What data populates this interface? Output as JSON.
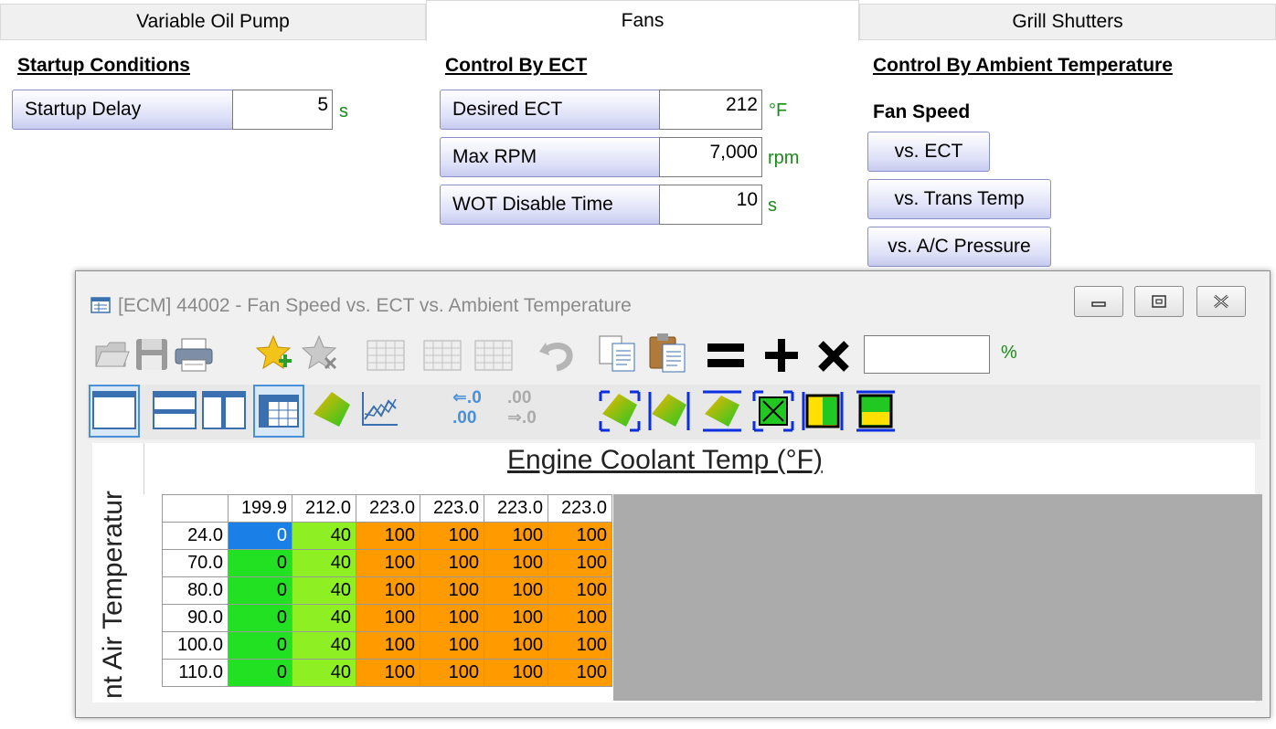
{
  "tabs": [
    {
      "label": "Variable Oil Pump"
    },
    {
      "label": "Fans"
    },
    {
      "label": "Grill Shutters"
    }
  ],
  "startup": {
    "title": "Startup Conditions",
    "delay_label": "Startup Delay",
    "delay_value": "5",
    "delay_unit": "s"
  },
  "ect_control": {
    "title": "Control By ECT",
    "desired_label": "Desired ECT",
    "desired_value": "212",
    "desired_unit": "°F",
    "maxrpm_label": "Max RPM",
    "maxrpm_value": "7,000",
    "maxrpm_unit": "rpm",
    "wot_label": "WOT Disable Time",
    "wot_value": "10",
    "wot_unit": "s"
  },
  "ambient_control": {
    "title": "Control By Ambient Temperature",
    "fan_speed_title": "Fan Speed",
    "btn_ect": "vs. ECT",
    "btn_trans": "vs. Trans Temp",
    "btn_ac": "vs. A/C Pressure"
  },
  "table_window": {
    "title": "[ECM] 44002 - Fan Speed vs. ECT vs. Ambient Temperature",
    "input_value": "",
    "input_unit": "%",
    "decimal_more": ".0",
    "decimal_more_2": ".00",
    "decimal_less": ".00",
    "decimal_less_2": ".0",
    "col_axis_title": "Engine Coolant Temp (°F)",
    "row_axis_title": "nt Air Temperatur",
    "col_headers": [
      "199.9",
      "212.0",
      "223.0",
      "223.0",
      "223.0",
      "223.0"
    ],
    "rows": [
      {
        "header": "24.0",
        "cells": [
          "0",
          "40",
          "100",
          "100",
          "100",
          "100"
        ]
      },
      {
        "header": "70.0",
        "cells": [
          "0",
          "40",
          "100",
          "100",
          "100",
          "100"
        ]
      },
      {
        "header": "80.0",
        "cells": [
          "0",
          "40",
          "100",
          "100",
          "100",
          "100"
        ]
      },
      {
        "header": "90.0",
        "cells": [
          "0",
          "40",
          "100",
          "100",
          "100",
          "100"
        ]
      },
      {
        "header": "100.0",
        "cells": [
          "0",
          "40",
          "100",
          "100",
          "100",
          "100"
        ]
      },
      {
        "header": "110.0",
        "cells": [
          "0",
          "40",
          "100",
          "100",
          "100",
          "100"
        ]
      }
    ]
  },
  "colors": {
    "cell_selected": "#1a7fe6",
    "cell_green": "#22e022",
    "cell_lightgreen": "#8ef022",
    "cell_orange": "#ff9a00",
    "unit_green": "#1a8a1a"
  }
}
